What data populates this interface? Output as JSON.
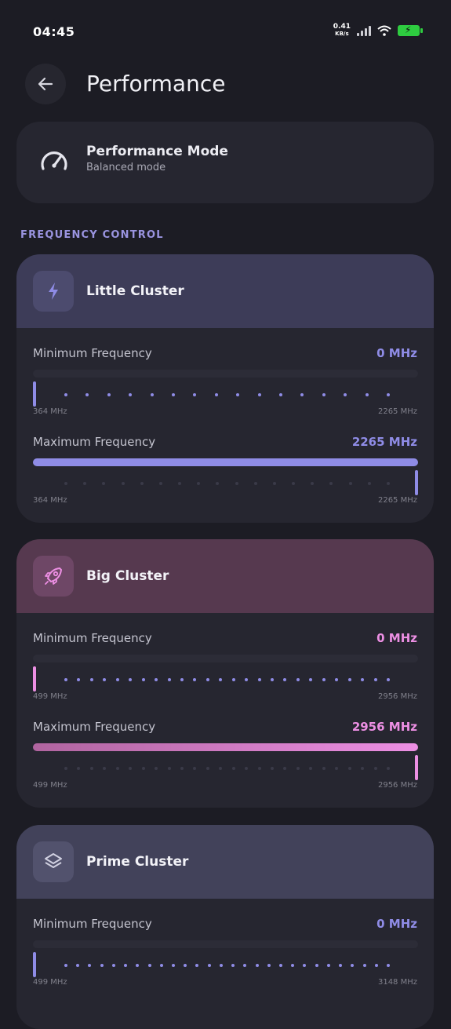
{
  "status": {
    "time": "04:45",
    "net_speed": "0.41",
    "net_unit": "KB/s"
  },
  "header": {
    "title": "Performance"
  },
  "mode": {
    "title": "Performance Mode",
    "subtitle": "Balanced mode"
  },
  "section": {
    "label": "FREQUENCY CONTROL"
  },
  "colors": {
    "little_accent": "#8f8ce6",
    "little_header": "#3d3c58",
    "big_accent": "#ec8fe3",
    "big_header": "#56394f",
    "prime_accent": "#8f8ce6",
    "prime_header": "#42425a",
    "card": "#262630"
  },
  "clusters": [
    {
      "name": "Little Cluster",
      "icon": "bolt-icon",
      "min": {
        "label": "Minimum Frequency",
        "value": "0 MHz",
        "level": 0,
        "range_min": "364 MHz",
        "range_max": "2265 MHz"
      },
      "max": {
        "label": "Maximum Frequency",
        "value": "2265 MHz",
        "level": 1,
        "range_min": "364 MHz",
        "range_max": "2265 MHz"
      }
    },
    {
      "name": "Big Cluster",
      "icon": "rocket-icon",
      "min": {
        "label": "Minimum Frequency",
        "value": "0 MHz",
        "level": 0,
        "range_min": "499 MHz",
        "range_max": "2956 MHz"
      },
      "max": {
        "label": "Maximum Frequency",
        "value": "2956 MHz",
        "level": 1,
        "range_min": "499 MHz",
        "range_max": "2956 MHz"
      }
    },
    {
      "name": "Prime Cluster",
      "icon": "layers-icon",
      "min": {
        "label": "Minimum Frequency",
        "value": "0 MHz",
        "level": 0,
        "range_min": "499 MHz",
        "range_max": "3148 MHz"
      }
    }
  ]
}
